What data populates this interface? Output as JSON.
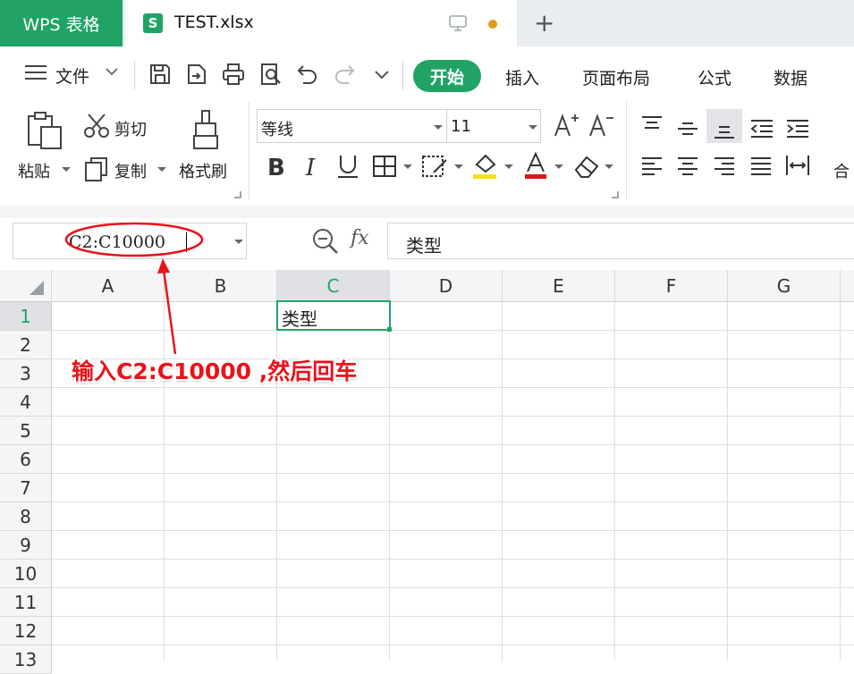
{
  "titlebar": {
    "app_name": "WPS 表格",
    "document_tab": "TEST.xlsx",
    "document_icon_letter": "S",
    "new_tab": "+"
  },
  "menu": {
    "file": "文件",
    "tabs": [
      "开始",
      "插入",
      "页面布局",
      "公式",
      "数据"
    ]
  },
  "ribbon": {
    "paste": "粘贴",
    "cut": "剪切",
    "copy": "复制",
    "format_painter": "格式刷",
    "font_name": "等线",
    "font_size": "11",
    "merge": "合"
  },
  "formula_bar": {
    "name_box": "C2:C10000",
    "formula": "类型",
    "fx": "fx"
  },
  "sheet": {
    "columns": [
      "A",
      "B",
      "C",
      "D",
      "E",
      "F",
      "G"
    ],
    "rows": [
      "1",
      "2",
      "3",
      "4",
      "5",
      "6",
      "7",
      "8",
      "9",
      "10",
      "11",
      "12",
      "13"
    ],
    "cell_C1": "类型",
    "active_column": "C",
    "active_row": "1"
  },
  "annotation": {
    "text": "输入C2:C10000 ,然后回车",
    "color": "#e8131a"
  },
  "colors": {
    "accent": "#21a366",
    "title_bg": "#e9ecf0"
  }
}
